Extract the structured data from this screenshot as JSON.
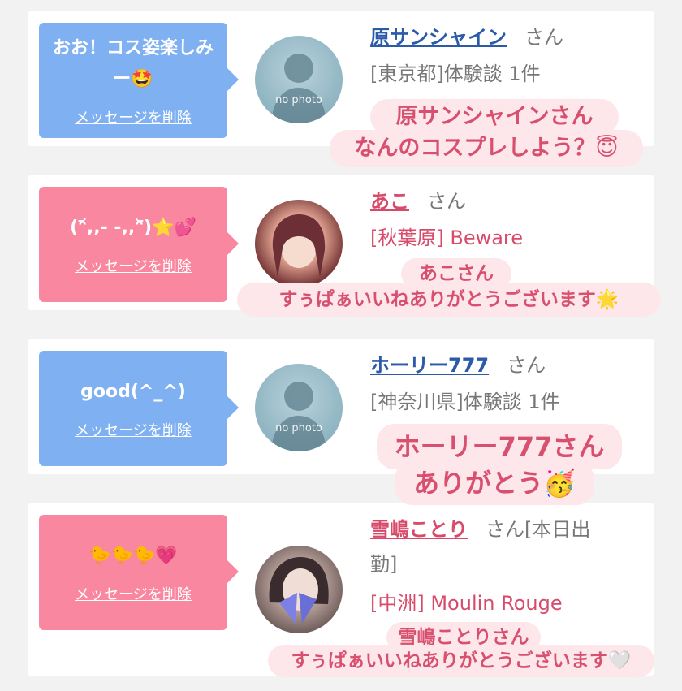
{
  "cards": [
    {
      "message": "おお！コス姿楽しみー🤩",
      "delete_label": "メッセージを削除",
      "name": "原サンシャイン",
      "honorific": "さん",
      "sub": "[東京都]体験談 1件",
      "avatar_label": "no photo",
      "overlay_top": "原サンシャインさん",
      "overlay_bottom": "なんのコスプレしよう？😇"
    },
    {
      "message": "(ᵔ᷄,,- -,,ᵔ᷅)⭐💕",
      "delete_label": "メッセージを削除",
      "name": "あこ",
      "honorific": "さん",
      "sub": "[秋葉原] Beware",
      "overlay_top": "あこさん",
      "overlay_bottom": "すぅぱぁいいねありがとうございます🌟"
    },
    {
      "message": "good(^_^)",
      "delete_label": "メッセージを削除",
      "name": "ホーリー777",
      "honorific": "さん",
      "sub": "[神奈川県]体験談 1件",
      "avatar_label": "no photo",
      "overlay_top": "ホーリー777さん",
      "overlay_bottom": "ありがとう🥳"
    },
    {
      "message": "🐤🐤🐤💗",
      "delete_label": "メッセージを削除",
      "name": "雪嶋ことり",
      "honorific": "さん[本日出",
      "honorific_cont": "勤]",
      "sub": "[中洲] Moulin Rouge",
      "overlay_top": "雪嶋ことりさん",
      "overlay_bottom": "すぅぱぁいいねありがとうございます🤍"
    }
  ]
}
